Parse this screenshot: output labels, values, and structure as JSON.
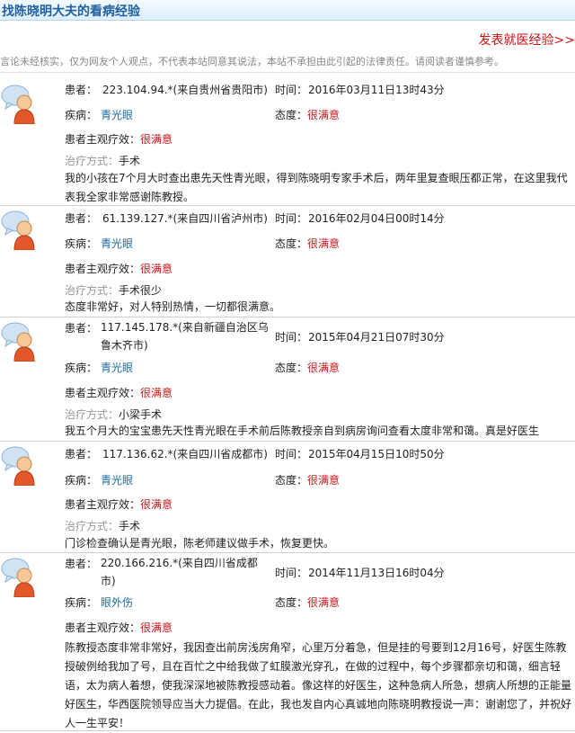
{
  "header": {
    "title": "找陈晓明大夫的看病经验"
  },
  "post_link": "发表就医经验>>",
  "disclaimer": "言论未经核实，仅为网友个人观点，不代表本站同意其说法，本站不承担由此引起的法律责任。请阅读者谨慎参考。",
  "labels": {
    "patient": "患者：",
    "time": "时间：",
    "disease": "疾病：",
    "attitude": "态度：",
    "effect": "患者主观疗效：",
    "treatment": "治疗方式："
  },
  "reviews": [
    {
      "patient": "223.104.94.*(来自贵州省贵阳市)",
      "time": "2016年03月11日13时43分",
      "disease": "青光眼",
      "attitude": "很满意",
      "effect": "很满意",
      "treatment": "手术",
      "text": "我的小孩在7个月大时查出患先天性青光眼，得到陈晓明专家手术后，两年里复查眼压都正常，在这里我代表我全家非常感谢陈教授。"
    },
    {
      "patient": "61.139.127.*(来自四川省泸州市)",
      "time": "2016年02月04日00时14分",
      "disease": "青光眼",
      "attitude": "很满意",
      "effect": "很满意",
      "treatment": "手术很少",
      "text": "态度非常好，对人特别热情，一切都很满意。"
    },
    {
      "patient": "117.145.178.*(来自新疆自治区乌鲁木齐市)",
      "time": "2015年04月21日07时30分",
      "disease": "青光眼",
      "attitude": "很满意",
      "effect": "很满意",
      "treatment": "小梁手术",
      "text": "我五个月大的宝宝患先天性青光眼在手术前后陈教授亲自到病房询问查看太度非常和蔼。真是好医生"
    },
    {
      "patient": "117.136.62.*(来自四川省成都市)",
      "time": "2015年04月15日10时50分",
      "disease": "青光眼",
      "attitude": "很满意",
      "effect": "很满意",
      "treatment": "手术",
      "text": "门诊检查确认是青光眼，陈老师建议做手术，恢复更快。"
    },
    {
      "patient": "220.166.216.*(来自四川省成都市)",
      "time": "2014年11月13日16时04分",
      "disease": "眼外伤",
      "attitude": "很满意",
      "effect": "很满意",
      "text": "陈教授态度非常非常好，我因查出前房浅房角窄，心里万分着急，但是挂的号要到12月16号，好医生陈教授破例给我加了号，且在百忙之中给我做了虹膜激光穿孔，在做的过程中，每个步骤都亲切和蔼，细言轻语，太为病人着想，使我深深地被陈教授感动着。像这样的好医生，这种急病人所急，想病人所想的正能量好医生，华西医院领导应当大力提倡。在此，我也发自内心真诚地向陈晓明教授说一声：谢谢您了，并祝好人一生平安！"
    }
  ]
}
